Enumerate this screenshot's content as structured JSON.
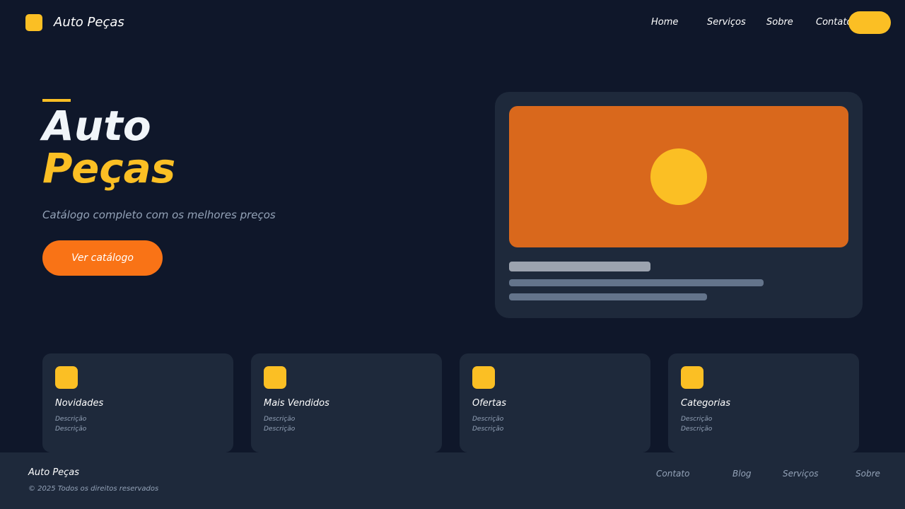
{
  "colors": {
    "background": "#0f172a",
    "surface": "#1e293b",
    "accent_yellow": "#fbbf24",
    "accent_orange": "#f97316",
    "image_orange": "#d9681c",
    "muted_text": "#94a3b8"
  },
  "header": {
    "brand": "Auto Peças",
    "logo_icon": "square-logo-icon",
    "nav": {
      "home": "Home",
      "servicos": "Serviços",
      "sobre": "Sobre",
      "contato": "Contato"
    }
  },
  "hero": {
    "title_line1": "Auto",
    "title_line2": "Peças",
    "subtitle": "Catálogo completo com os melhores preços",
    "button_label": "Ver catálogo"
  },
  "cards": [
    {
      "title": "Novidades",
      "desc1": "Descrição",
      "desc2": "Descrição",
      "icon": "square-icon"
    },
    {
      "title": "Mais Vendidos",
      "desc1": "Descrição",
      "desc2": "Descrição",
      "icon": "square-icon"
    },
    {
      "title": "Ofertas",
      "desc1": "Descrição",
      "desc2": "Descrição",
      "icon": "square-icon"
    },
    {
      "title": "Categorias",
      "desc1": "Descrição",
      "desc2": "Descrição",
      "icon": "square-icon"
    }
  ],
  "footer": {
    "brand": "Auto Peças",
    "copyright": "© 2025 Todos os direitos reservados",
    "links": {
      "contato": "Contato",
      "blog": "Blog",
      "servicos": "Serviços",
      "sobre": "Sobre"
    }
  }
}
